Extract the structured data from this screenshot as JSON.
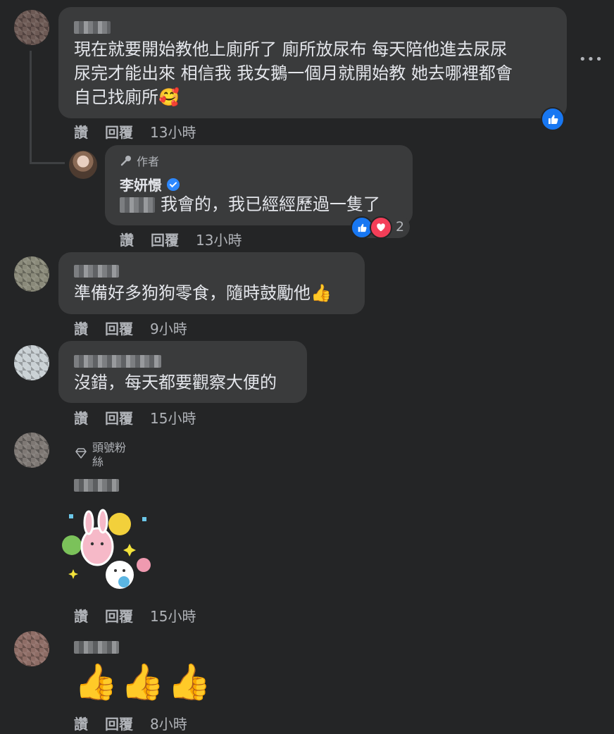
{
  "more_menu_label": "•••",
  "actions": {
    "like": "讚",
    "reply": "回覆"
  },
  "comments": [
    {
      "text_lines": [
        "現在就要開始教他上廁所了 廁所放尿布 每天陪他進去尿尿",
        "尿完才能出來 相信我 我女鵝一個月就開始教 她去哪裡都會",
        "自己找廁所"
      ],
      "emoji": "🥰",
      "time": "13小時",
      "reaction": "like"
    },
    {
      "author_badge": "作者",
      "author_name": "李妍憬",
      "text": "我會的，我已經經歷過一隻了",
      "time": "13小時",
      "reaction_count": "2"
    },
    {
      "text": "準備好多狗狗零食，隨時鼓勵他",
      "emoji": "👍",
      "time": "9小時"
    },
    {
      "text": "沒錯，每天都要觀察大便的",
      "time": "15小時"
    },
    {
      "fan_badge": "頭號粉絲",
      "time": "15小時"
    },
    {
      "emoji_text": "👍👍👍",
      "time": "8小時"
    }
  ],
  "colors": {
    "background": "#242526",
    "bubble": "#3a3b3c",
    "like_blue": "#1877f2",
    "love_red": "#f33e58",
    "verified": "#2d88ff"
  }
}
